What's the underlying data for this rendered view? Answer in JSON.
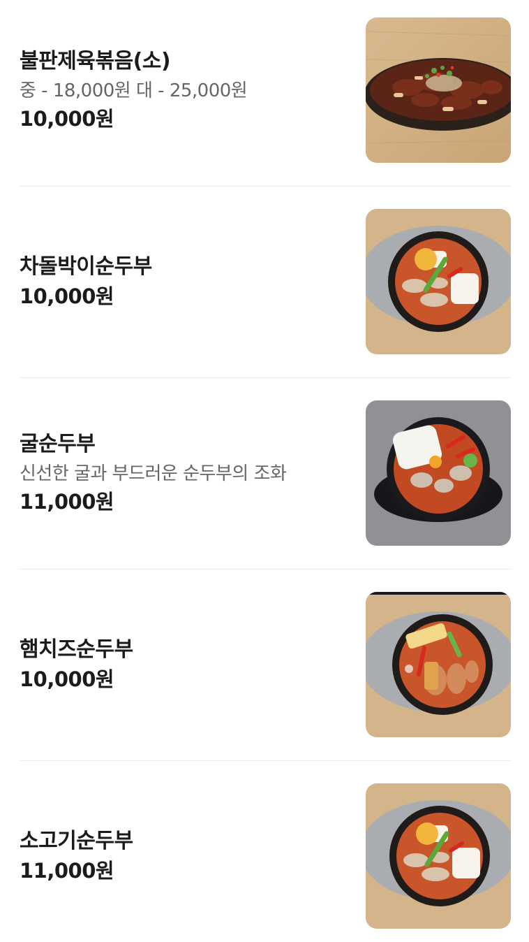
{
  "menu": {
    "items": [
      {
        "name": "불판제육볶음(소)",
        "desc": "중 - 18,000원 대 - 25,000원",
        "price": "10,000원",
        "image": "spicy-pork-on-sizzling-plate"
      },
      {
        "name": "차돌박이순두부",
        "price": "10,000원",
        "image": "brisket-soft-tofu-stew"
      },
      {
        "name": "굴순두부",
        "desc": "신선한 굴과 부드러운 순두부의 조화",
        "price": "11,000원",
        "image": "oyster-soft-tofu-stew"
      },
      {
        "name": "햄치즈순두부",
        "price": "10,000원",
        "image": "ham-cheese-soft-tofu-stew"
      },
      {
        "name": "소고기순두부",
        "price": "11,000원",
        "image": "beef-soft-tofu-stew"
      }
    ]
  },
  "colors": {
    "text_primary": "#1b1b1b",
    "text_secondary": "#666666",
    "divider": "#ededed"
  }
}
